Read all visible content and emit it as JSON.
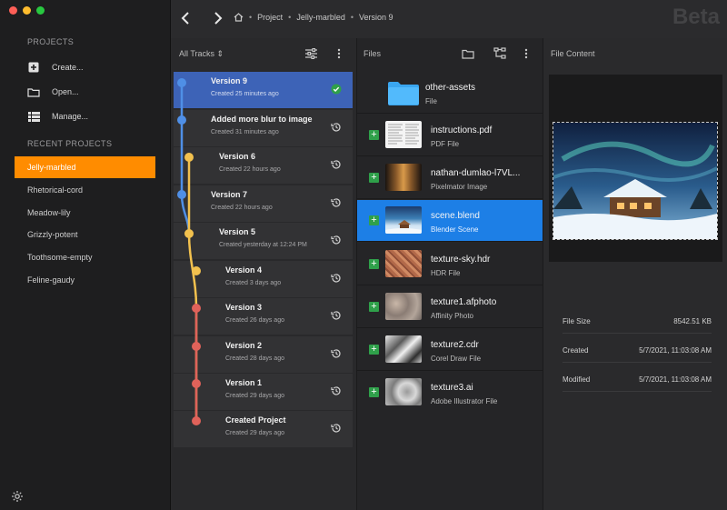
{
  "sidebar": {
    "projects_heading": "PROJECTS",
    "actions": [
      {
        "label": "Create...",
        "icon": "plus-square-icon"
      },
      {
        "label": "Open...",
        "icon": "folder-icon"
      },
      {
        "label": "Manage...",
        "icon": "list-icon"
      }
    ],
    "recent_heading": "RECENT PROJECTS",
    "recent": [
      {
        "label": "Jelly-marbled",
        "active": true
      },
      {
        "label": "Rhetorical-cord",
        "active": false
      },
      {
        "label": "Meadow-lily",
        "active": false
      },
      {
        "label": "Grizzly-potent",
        "active": false
      },
      {
        "label": "Toothsome-empty",
        "active": false
      },
      {
        "label": "Feline-gaudy",
        "active": false
      }
    ]
  },
  "topbar": {
    "breadcrumb": [
      "Project",
      "Jelly-marbled",
      "Version 9"
    ],
    "badge": "Beta"
  },
  "tracks": {
    "filter_label": "All Tracks",
    "items": [
      {
        "title": "Version 9",
        "subtitle": "Created 25 minutes ago",
        "selected": true,
        "status": "check-icon"
      },
      {
        "title": "Added more blur to image",
        "subtitle": "Created 31 minutes ago",
        "selected": false,
        "status": "history-icon"
      },
      {
        "title": "Version 6",
        "subtitle": "Created 22 hours ago",
        "selected": false,
        "status": "history-icon"
      },
      {
        "title": "Version 7",
        "subtitle": "Created 22 hours ago",
        "selected": false,
        "status": "history-icon"
      },
      {
        "title": "Version 5",
        "subtitle": "Created yesterday at 12:24 PM",
        "selected": false,
        "status": "history-icon"
      },
      {
        "title": "Version 4",
        "subtitle": "Created 3 days ago",
        "selected": false,
        "status": "history-icon"
      },
      {
        "title": "Version 3",
        "subtitle": "Created 26 days ago",
        "selected": false,
        "status": "history-icon"
      },
      {
        "title": "Version 2",
        "subtitle": "Created 28 days ago",
        "selected": false,
        "status": "history-icon"
      },
      {
        "title": "Version 1",
        "subtitle": "Created 29 days ago",
        "selected": false,
        "status": "history-icon"
      },
      {
        "title": "Created Project",
        "subtitle": "Created 29 days ago",
        "selected": false,
        "status": "history-icon"
      }
    ],
    "branch_colors": {
      "blue": "#4f8fe6",
      "yellow": "#f2c14e",
      "red": "#e0625a"
    }
  },
  "files": {
    "heading": "Files",
    "items": [
      {
        "name": "other-assets",
        "type": "File",
        "folder": true
      },
      {
        "name": "instructions.pdf",
        "type": "PDF File"
      },
      {
        "name": "nathan-dumlao-l7VL...",
        "type": "Pixelmator Image"
      },
      {
        "name": "scene.blend",
        "type": "Blender Scene",
        "selected": true
      },
      {
        "name": "texture-sky.hdr",
        "type": "HDR File"
      },
      {
        "name": "texture1.afphoto",
        "type": "Affinity Photo"
      },
      {
        "name": "texture2.cdr",
        "type": "Corel Draw File"
      },
      {
        "name": "texture3.ai",
        "type": "Adobe Illustrator File"
      }
    ]
  },
  "content": {
    "heading": "File Content",
    "meta": [
      {
        "label": "File Size",
        "value": "8542.51 KB"
      },
      {
        "label": "Created",
        "value": "5/7/2021, 11:03:08 AM"
      },
      {
        "label": "Modified",
        "value": "5/7/2021, 11:03:08 AM"
      }
    ]
  },
  "colors": {
    "accent": "#ff8c00",
    "selection": "#3d63b7",
    "file_selection": "#1d7fe6",
    "add": "#2fa04a"
  }
}
